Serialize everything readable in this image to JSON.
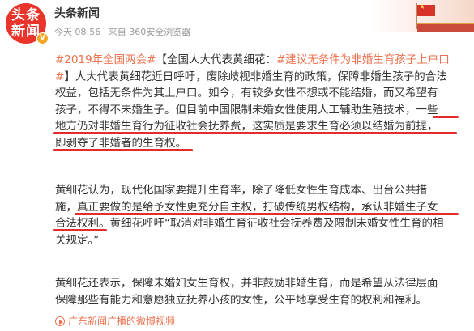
{
  "account": {
    "avatar_lines": [
      "头条",
      "新闻"
    ],
    "verified_mark": "V",
    "name": "头条新闻",
    "time": "今天 08:56",
    "source": "来自 360安全浏览器"
  },
  "post": {
    "para1": [
      [
        "#2019年全国两会#",
        "【全国人大代表黄细花：",
        "#建议无条件为非婚生育孩子上户口"
      ],
      [
        "#",
        "】人大代表黄细花近日呼吁，废除歧视非婚生育的政策，保障非婚生孩子的合法"
      ],
      [
        "权益，包括无条件为其上户口。如今，有较多女性不想或不能结婚，而又希望有"
      ],
      [
        "孩子，不得不未婚生子。但目前中国限制未婚女性使用人工辅助生殖技术，",
        "一些"
      ],
      [
        "地方仍对非婚生育行为征收社会抚养费，这实质是要求生育必须以结婚为前提，"
      ],
      [
        "即剥夺了非婚者的生育权。"
      ]
    ],
    "para2": [
      [
        "黄细花认为，现代化国家要提升生育率，除了降低女性生育成本、出台公共措"
      ],
      [
        "施，",
        "真正要做的是给予女性更充分自主权，打破传统男权结构，承认非婚生子女"
      ],
      [
        "合法权利。",
        "黄细花呼吁“取消对非婚生育征收社会抚养费及限制未婚女性生育的相"
      ],
      [
        "关规定。”"
      ]
    ],
    "para3": [
      [
        "黄细花还表示，保障未婚妇女生育权，并非鼓励非婚生育，而是希望从法律层面"
      ],
      [
        "保障那些有能力和意愿独立抚养小孩的女性，公平地享受生育的权利和福利。"
      ]
    ],
    "video_link": "广东新闻广播的微博视频"
  },
  "colors": {
    "accent": "#eb7350",
    "underline": "#e52b2b",
    "text": "#333333",
    "meta": "#999999"
  }
}
